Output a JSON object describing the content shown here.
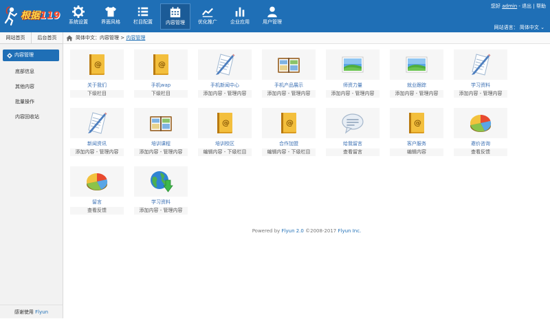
{
  "colors": {
    "brand": "#1f6fb6",
    "nav_active": "#1b5b97",
    "link": "#3a6fb3"
  },
  "header": {
    "logo": {
      "text": "根据",
      "number": "119"
    },
    "nav": [
      {
        "label": "系统设置",
        "icon": "gear-icon"
      },
      {
        "label": "界面风格",
        "icon": "shirt-icon"
      },
      {
        "label": "栏目配置",
        "icon": "list-icon"
      },
      {
        "label": "内容管理",
        "icon": "calendar-icon",
        "active": true
      },
      {
        "label": "优化推广",
        "icon": "trend-chart-icon"
      },
      {
        "label": "企业应用",
        "icon": "bar-chart-icon"
      },
      {
        "label": "用户管理",
        "icon": "user-icon"
      }
    ],
    "user": {
      "greeting": "您好",
      "name": "admin",
      "sep1": "-",
      "logout": "退出",
      "sep2": "|",
      "help": "帮助"
    },
    "lang": {
      "label": "网站语言：",
      "value": "简体中文",
      "arrow": "⌄"
    }
  },
  "sidebar": {
    "tabs": [
      "网站首页",
      "后台首页"
    ],
    "active": "内容管理",
    "items": [
      "底部信息",
      "其他内容",
      "批量操作",
      "内容回收站"
    ],
    "footer": {
      "text": "感谢使用",
      "brand": "Flyun"
    }
  },
  "breadcrumb": {
    "lang": "简体中文",
    "sep": "：",
    "section": "内容管理",
    "arrow": " > ",
    "current": "内容管理"
  },
  "tiles": [
    {
      "title": "关于我们",
      "actions": "下级栏目",
      "icon": "book-icon"
    },
    {
      "title": "手机wap",
      "actions": "下级栏目",
      "icon": "book-icon"
    },
    {
      "title": "手机新闻中心",
      "actions": "添加内容 - 管理内容",
      "icon": "document-icon"
    },
    {
      "title": "手机产品展示",
      "actions": "添加内容 - 管理内容",
      "icon": "photo-album-icon"
    },
    {
      "title": "师资力量",
      "actions": "添加内容 - 管理内容",
      "icon": "landscape-icon"
    },
    {
      "title": "就业跟踪",
      "actions": "添加内容 - 管理内容",
      "icon": "landscape-icon"
    },
    {
      "title": "学习资料",
      "actions": "添加内容 - 管理内容",
      "icon": "document-icon"
    },
    {
      "title": "新闻资讯",
      "actions": "添加内容 - 管理内容",
      "icon": "document-icon"
    },
    {
      "title": "培训课程",
      "actions": "添加内容 - 管理内容",
      "icon": "photo-album-icon"
    },
    {
      "title": "培训校区",
      "actions": "编辑内容 - 下级栏目",
      "icon": "book-icon"
    },
    {
      "title": "合作加盟",
      "actions": "编辑内容 - 下级栏目",
      "icon": "book-icon"
    },
    {
      "title": "给我留言",
      "actions": "查看留言",
      "icon": "speech-bubble-icon"
    },
    {
      "title": "客户服务",
      "actions": "编辑内容",
      "icon": "book-icon"
    },
    {
      "title": "邀价咨询",
      "actions": "查看反馈",
      "icon": "pie-chart-icon"
    },
    {
      "title": "留言",
      "actions": "查看反馈",
      "icon": "pie-chart-icon"
    },
    {
      "title": "学习资料",
      "actions": "添加内容 - 管理内容",
      "icon": "globe-download-icon"
    }
  ],
  "footer": {
    "prefix": "Powered by",
    "product": "Flyun 2.0",
    "copyright": "©2008-2017",
    "company": "Flyun Inc."
  }
}
